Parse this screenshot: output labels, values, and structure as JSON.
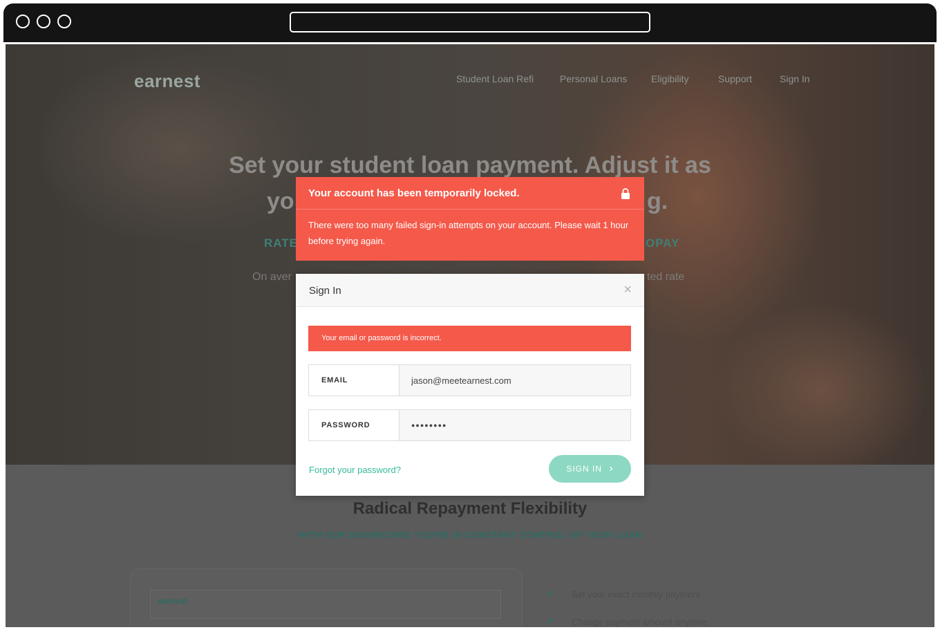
{
  "browser": {
    "url": ""
  },
  "site": {
    "logo": "earnest",
    "nav": [
      "Student Loan Refi",
      "Personal Loans",
      "Eligibility",
      "Support",
      "Sign In"
    ],
    "hero_title_line1": "Set your student loan payment. Adjust it as",
    "hero_title_line2_left": "yo",
    "hero_title_line2_right": "g.",
    "hero_rate_left": "RATE",
    "hero_rate_right": "OPAY",
    "hero_small_left": "On aver",
    "hero_small_right": "ted rate"
  },
  "section": {
    "title": "Radical Repayment Flexibility",
    "subtitle": "WITH OUR DASHBOARD YOU'RE IN CONSTANT CONTROL OF YOUR LOAN",
    "dashboard_logo": "earnest",
    "features": [
      "Set your exact monthly payment",
      "Change payment amount anytime"
    ]
  },
  "alert": {
    "title": "Your account has been temporarily locked.",
    "body": "There were too many failed sign-in attempts on your account. Please wait 1 hour before trying again.",
    "icon": "lock-icon"
  },
  "modal": {
    "title": "Sign In",
    "close_glyph": "×",
    "error": "Your email or password is incorrect.",
    "email_label": "EMAIL",
    "email_value": "jason@meetearnest.com",
    "password_label": "PASSWORD",
    "password_value": "●●●●●●●●",
    "forgot": "Forgot your password?",
    "signin_label": "SIGN IN",
    "signin_arrow": "›"
  },
  "colors": {
    "alert": "#f4594a",
    "accent": "#35b99a",
    "button": "#8dd8c2"
  }
}
